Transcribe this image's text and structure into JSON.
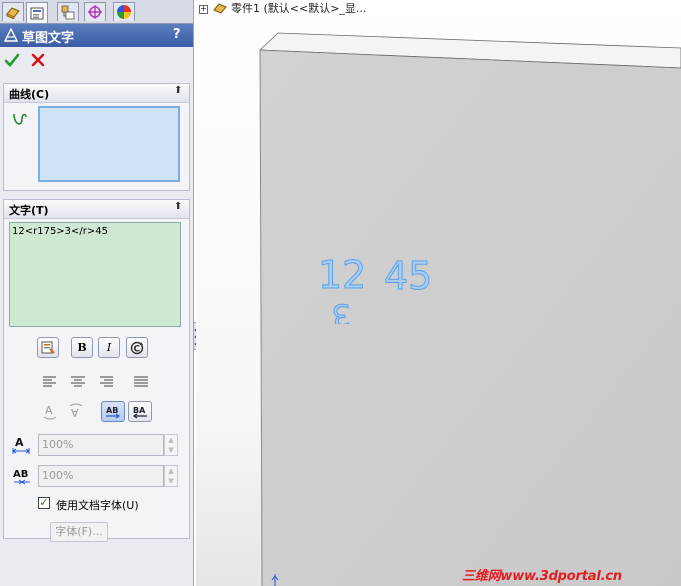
{
  "tree_label": "零件1  (默认<<默认>_显...",
  "panel": {
    "title": "草图文字",
    "help": "?",
    "curve_group": {
      "title": "曲线(C)"
    },
    "text_group": {
      "title": "文字(T)",
      "text_value": "12<r175>3</r>45",
      "width_factor": "100%",
      "spacing": "100%",
      "use_doc_font_label": "使用文档字体(U)",
      "use_doc_font_checked": true,
      "font_button": "字体(F)..."
    }
  },
  "viewport": {
    "sketch_text_left": "12",
    "sketch_text_rotated": "3",
    "sketch_text_right": "45"
  },
  "watermark": "三维网www.3dportal.cn",
  "colors": {
    "title_bar": "#4a6db3",
    "curve_box": "#cfe3f8",
    "text_area": "#cfe8d2",
    "sketch_text": "#5aa0e8",
    "part_face": "#cfcfcf",
    "watermark": "#e21e22"
  }
}
